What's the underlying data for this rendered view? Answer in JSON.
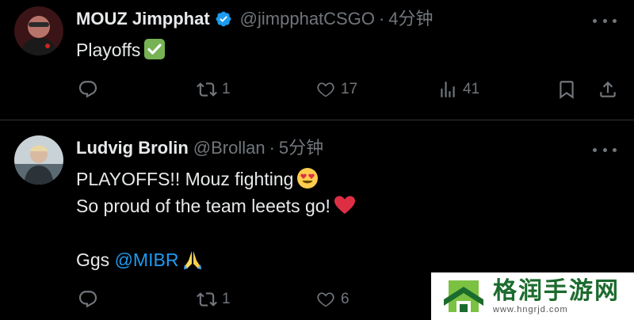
{
  "tweets": [
    {
      "name": "MOUZ Jimpphat",
      "verified": true,
      "handle": "@jimpphatCSGO",
      "dot": "·",
      "time": "4分钟",
      "text": "Playoffs",
      "emoji": "check-mark-button",
      "actions": {
        "reply": "",
        "retweet": "1",
        "like": "17",
        "views": "41"
      }
    },
    {
      "name": "Ludvig Brolin",
      "verified": false,
      "handle": "@Brollan",
      "dot": "·",
      "time": "5分钟",
      "lines": {
        "l1": "PLAYOFFS!! Mouz fighting",
        "l2": "So proud of the team leeets go!",
        "l3_prefix": "Ggs ",
        "l3_mention": "@MIBR"
      },
      "emojis": [
        "heart-eyes-emoji",
        "red-heart-emoji",
        "folded-hands-emoji"
      ],
      "actions": {
        "reply": "",
        "retweet": "1",
        "like": "6"
      }
    }
  ],
  "watermark": {
    "title": "格润手游网",
    "url": "www.hngrjd.com"
  },
  "colors": {
    "background": "#000000",
    "text": "#e7e9ea",
    "muted": "#71767b",
    "link": "#1d9bf0",
    "verified": "#1d9bf0",
    "divider": "#2f3336"
  }
}
